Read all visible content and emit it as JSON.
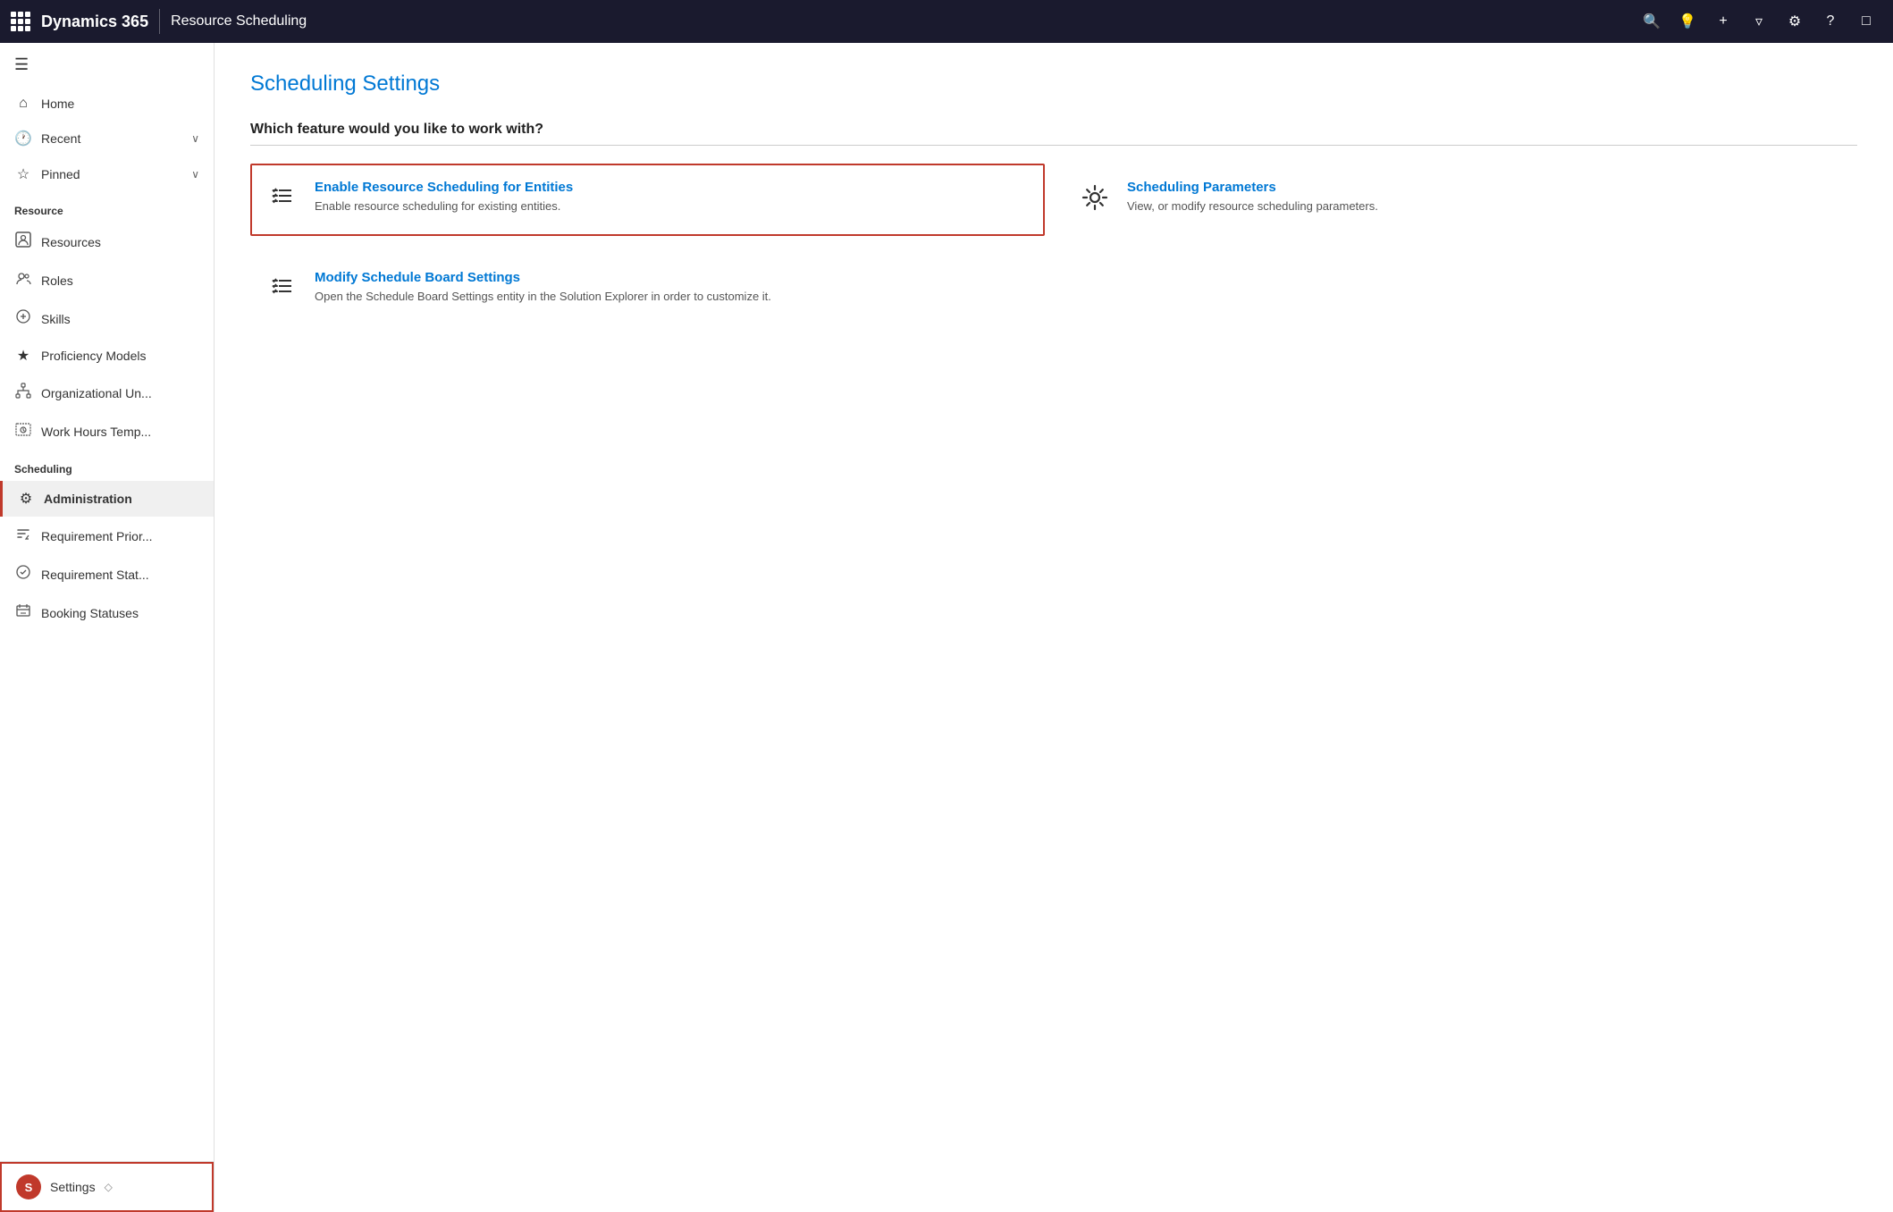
{
  "topnav": {
    "brand": "Dynamics 365",
    "module": "Resource Scheduling",
    "icons": [
      "search",
      "lightbulb",
      "plus",
      "filter",
      "settings",
      "help",
      "feedback"
    ]
  },
  "sidebar": {
    "toggle_icon": "≡",
    "nav_items": [
      {
        "id": "home",
        "label": "Home",
        "icon": "⌂"
      },
      {
        "id": "recent",
        "label": "Recent",
        "icon": "🕐",
        "chevron": "∨"
      },
      {
        "id": "pinned",
        "label": "Pinned",
        "icon": "☆",
        "chevron": "∨"
      }
    ],
    "resource_section": "Resource",
    "resource_items": [
      {
        "id": "resources",
        "label": "Resources",
        "icon": "👤"
      },
      {
        "id": "roles",
        "label": "Roles",
        "icon": "👤"
      },
      {
        "id": "skills",
        "label": "Skills",
        "icon": "👤"
      },
      {
        "id": "proficiency",
        "label": "Proficiency Models",
        "icon": "★"
      },
      {
        "id": "orgunit",
        "label": "Organizational Un...",
        "icon": "⬡"
      },
      {
        "id": "workhours",
        "label": "Work Hours Temp...",
        "icon": "⊡"
      }
    ],
    "scheduling_section": "Scheduling",
    "scheduling_items": [
      {
        "id": "administration",
        "label": "Administration",
        "icon": "⚙",
        "active": true
      },
      {
        "id": "reqpriority",
        "label": "Requirement Prior...",
        "icon": "↕"
      },
      {
        "id": "reqstatus",
        "label": "Requirement Stat...",
        "icon": "👤"
      },
      {
        "id": "booking",
        "label": "Booking Statuses",
        "icon": "⚑"
      }
    ],
    "settings_label": "Settings",
    "settings_icon": "S"
  },
  "content": {
    "page_title": "Scheduling Settings",
    "section_question": "Which feature would you like to work with?",
    "features": [
      {
        "id": "enable-resource",
        "title": "Enable Resource Scheduling for Entities",
        "description": "Enable resource scheduling for existing entities.",
        "icon": "checklist",
        "highlighted": true
      },
      {
        "id": "scheduling-parameters",
        "title": "Scheduling Parameters",
        "description": "View, or modify resource scheduling parameters.",
        "icon": "gear",
        "highlighted": false
      },
      {
        "id": "modify-board",
        "title": "Modify Schedule Board Settings",
        "description": "Open the Schedule Board Settings entity in the Solution Explorer in order to customize it.",
        "icon": "checklist",
        "highlighted": false
      }
    ]
  }
}
